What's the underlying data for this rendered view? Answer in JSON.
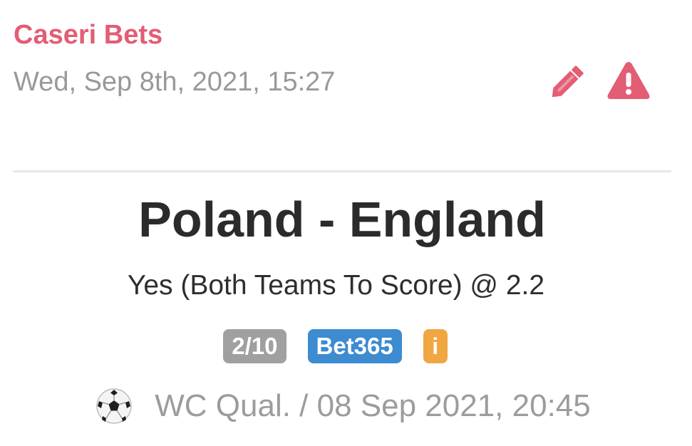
{
  "tip": {
    "tipster_name": "Caseri Bets",
    "posted_at": "Wed, Sep 8th, 2021, 15:27",
    "match": "Poland - England",
    "pick": "Yes (Both Teams To Score) @ 2.2",
    "badges": {
      "stake": "2/10",
      "bookmaker": "Bet365",
      "info": "i"
    },
    "event": "WC Qual. / 08 Sep 2021, 20:45",
    "sport_icon": "soccer-ball-icon"
  },
  "actions": {
    "edit_icon": "pencil-icon",
    "report_icon": "warning-icon"
  },
  "colors": {
    "accent": "#e35d74",
    "muted_text": "#999999",
    "title_text": "#2b2b2b",
    "badge_stake": "#a0a0a0",
    "badge_bookmaker": "#3d8bd0",
    "badge_info": "#f0a742",
    "divider": "#e8e8e8"
  }
}
